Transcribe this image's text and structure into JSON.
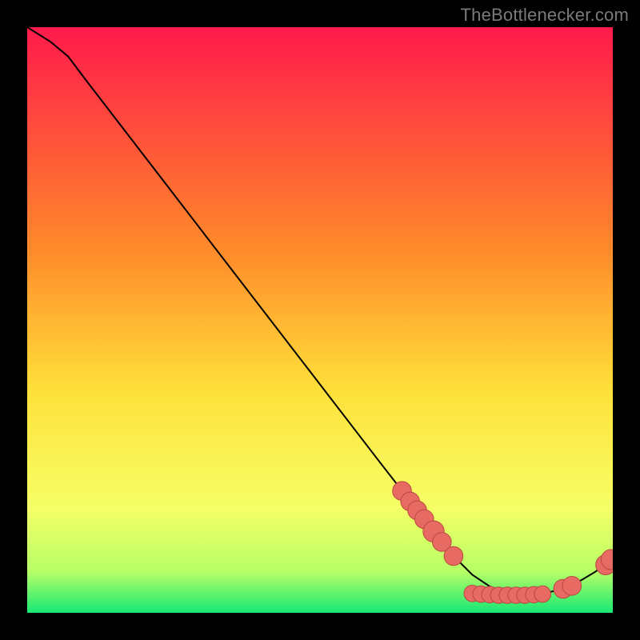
{
  "watermark": "TheBottlenecker.com",
  "colors": {
    "bg_black": "#000000",
    "grad_top": "#ff1a4b",
    "grad_mid1": "#ff8a2a",
    "grad_mid2": "#ffe03a",
    "grad_low1": "#f6ff66",
    "grad_low2": "#b6ff66",
    "grad_bottom": "#17e874",
    "curve": "#000000",
    "marker_fill": "#e86b63",
    "marker_stroke": "#b94840"
  },
  "chart_data": {
    "type": "line",
    "title": "",
    "xlabel": "",
    "ylabel": "",
    "xlim": [
      0,
      100
    ],
    "ylim": [
      0,
      100
    ],
    "curve": [
      {
        "x": 0,
        "y": 100
      },
      {
        "x": 4,
        "y": 97.5
      },
      {
        "x": 7,
        "y": 95
      },
      {
        "x": 10,
        "y": 91
      },
      {
        "x": 20,
        "y": 78
      },
      {
        "x": 30,
        "y": 65
      },
      {
        "x": 40,
        "y": 52
      },
      {
        "x": 50,
        "y": 39
      },
      {
        "x": 60,
        "y": 26
      },
      {
        "x": 67,
        "y": 17
      },
      {
        "x": 70,
        "y": 13
      },
      {
        "x": 73,
        "y": 9.5
      },
      {
        "x": 76,
        "y": 6.5
      },
      {
        "x": 79,
        "y": 4.5
      },
      {
        "x": 82,
        "y": 3.4
      },
      {
        "x": 85,
        "y": 3.0
      },
      {
        "x": 88,
        "y": 3.2
      },
      {
        "x": 91,
        "y": 4.0
      },
      {
        "x": 94,
        "y": 5.2
      },
      {
        "x": 97,
        "y": 7.0
      },
      {
        "x": 99,
        "y": 8.5
      },
      {
        "x": 100,
        "y": 9.3
      }
    ],
    "markers": [
      {
        "x": 64.0,
        "y": 20.8,
        "r": 1.2
      },
      {
        "x": 65.4,
        "y": 19.0,
        "r": 1.2
      },
      {
        "x": 66.6,
        "y": 17.5,
        "r": 1.2
      },
      {
        "x": 67.8,
        "y": 16.0,
        "r": 1.2
      },
      {
        "x": 69.4,
        "y": 13.9,
        "r": 1.4
      },
      {
        "x": 70.8,
        "y": 12.1,
        "r": 1.2
      },
      {
        "x": 72.8,
        "y": 9.7,
        "r": 1.2
      },
      {
        "x": 76.0,
        "y": 3.3,
        "r": 1.0
      },
      {
        "x": 77.5,
        "y": 3.2,
        "r": 1.0
      },
      {
        "x": 79.0,
        "y": 3.1,
        "r": 1.0
      },
      {
        "x": 80.5,
        "y": 3.0,
        "r": 1.0
      },
      {
        "x": 82.0,
        "y": 3.0,
        "r": 1.0
      },
      {
        "x": 83.5,
        "y": 3.0,
        "r": 1.0
      },
      {
        "x": 85.0,
        "y": 3.0,
        "r": 1.0
      },
      {
        "x": 86.5,
        "y": 3.1,
        "r": 1.0
      },
      {
        "x": 88.0,
        "y": 3.2,
        "r": 1.0
      },
      {
        "x": 91.5,
        "y": 4.1,
        "r": 1.2
      },
      {
        "x": 93.0,
        "y": 4.6,
        "r": 1.2
      },
      {
        "x": 98.8,
        "y": 8.2,
        "r": 1.3
      },
      {
        "x": 99.7,
        "y": 9.1,
        "r": 1.3
      }
    ],
    "annotations": []
  }
}
